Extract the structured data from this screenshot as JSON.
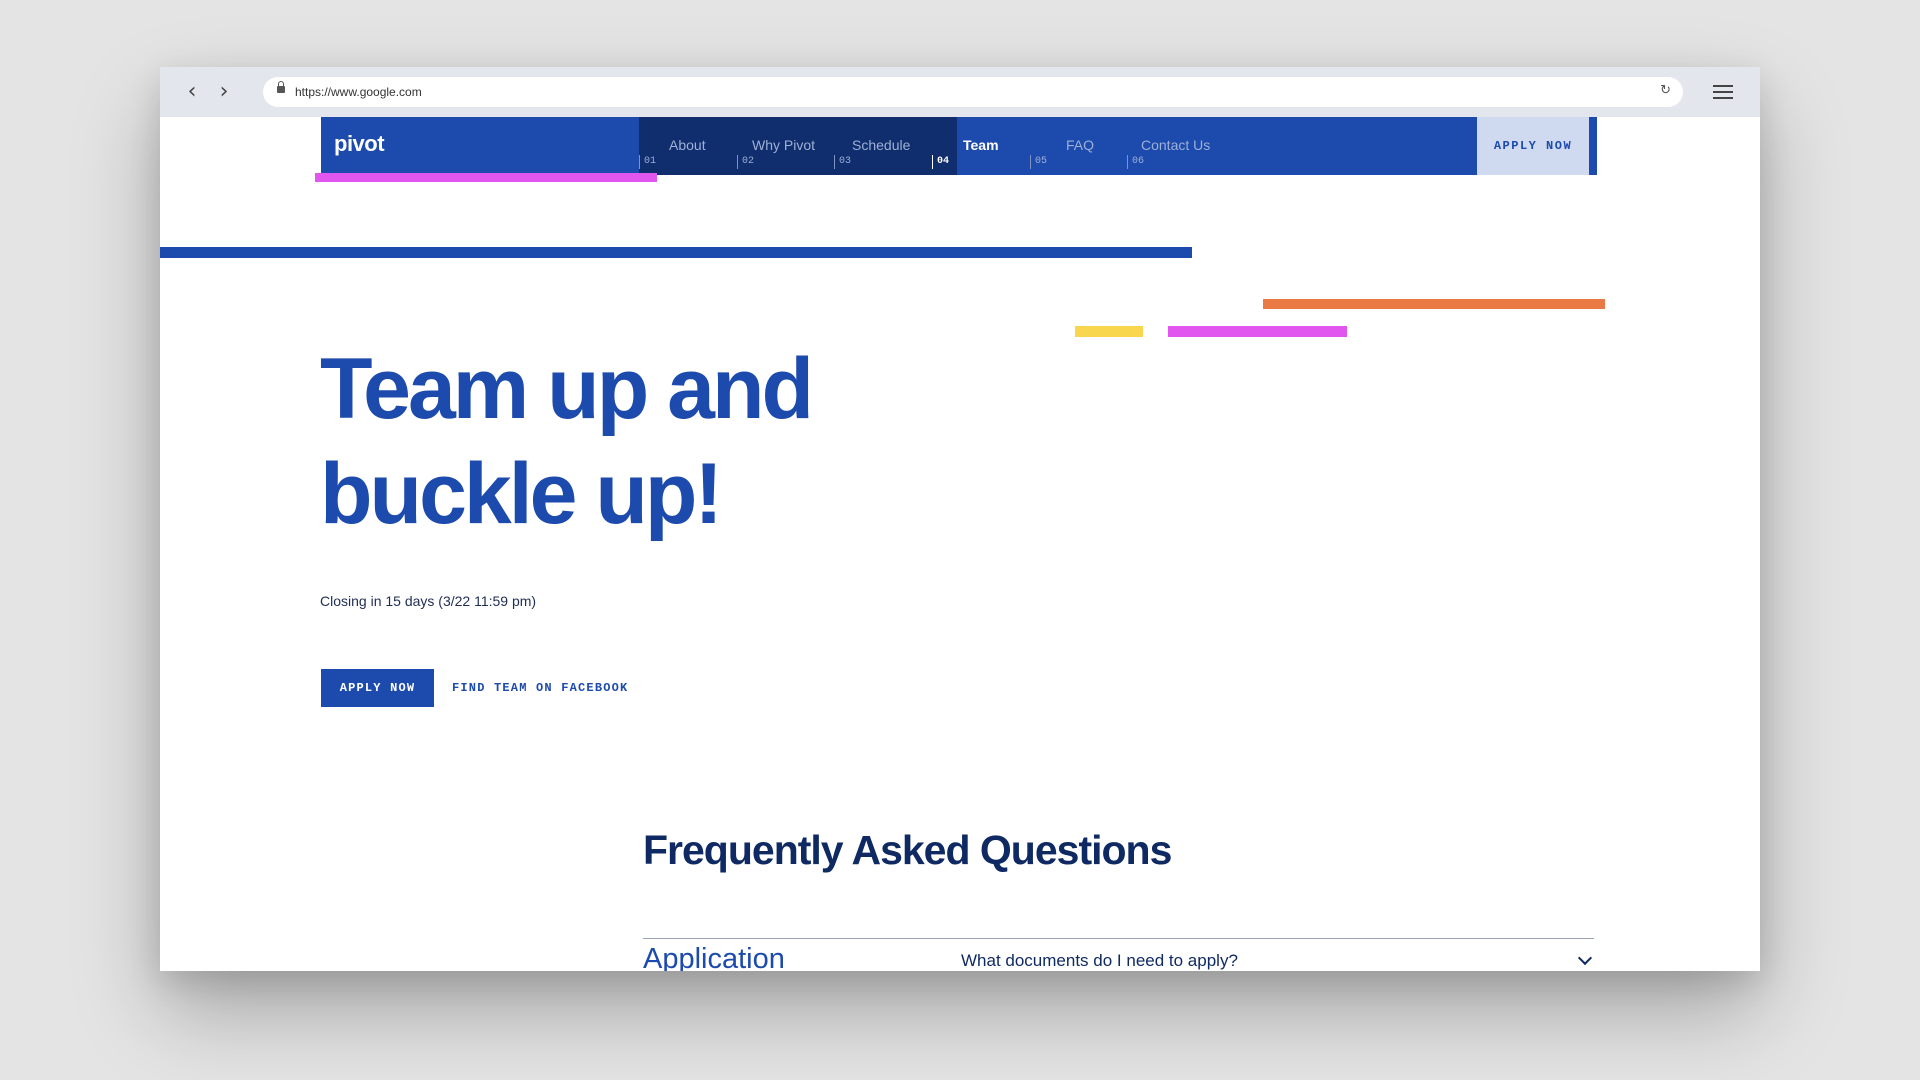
{
  "browser": {
    "url": "https://www.google.com",
    "back_icon": "chevron-left-icon",
    "forward_icon": "chevron-right-icon",
    "reload_icon": "reload-icon",
    "menu_icon": "hamburger-menu-icon"
  },
  "site_nav": {
    "logo": "pivot",
    "items": [
      {
        "label": "About",
        "num": "01",
        "active": false
      },
      {
        "label": "Why Pivot",
        "num": "02",
        "active": false
      },
      {
        "label": "Schedule",
        "num": "03",
        "active": false
      },
      {
        "label": "Team",
        "num": "04",
        "active": true
      },
      {
        "label": "FAQ",
        "num": "05",
        "active": false
      },
      {
        "label": "Contact Us",
        "num": "06",
        "active": false
      }
    ],
    "apply_label": "APPLY NOW"
  },
  "hero": {
    "title_line1": "Team up and",
    "title_line2": "buckle up!",
    "closing": "Closing in 15 days (3/22 11:59 pm)",
    "apply_label": "APPLY NOW",
    "facebook_label": "FIND TEAM ON FACEBOOK"
  },
  "faq": {
    "title": "Frequently Asked Questions",
    "category": "Application",
    "question": "What documents do I need to apply?"
  },
  "colors": {
    "primary": "#1c4aad",
    "navy": "#102d6e",
    "magenta": "#e256f0",
    "orange": "#ea7a45",
    "yellow": "#f8d64e"
  }
}
